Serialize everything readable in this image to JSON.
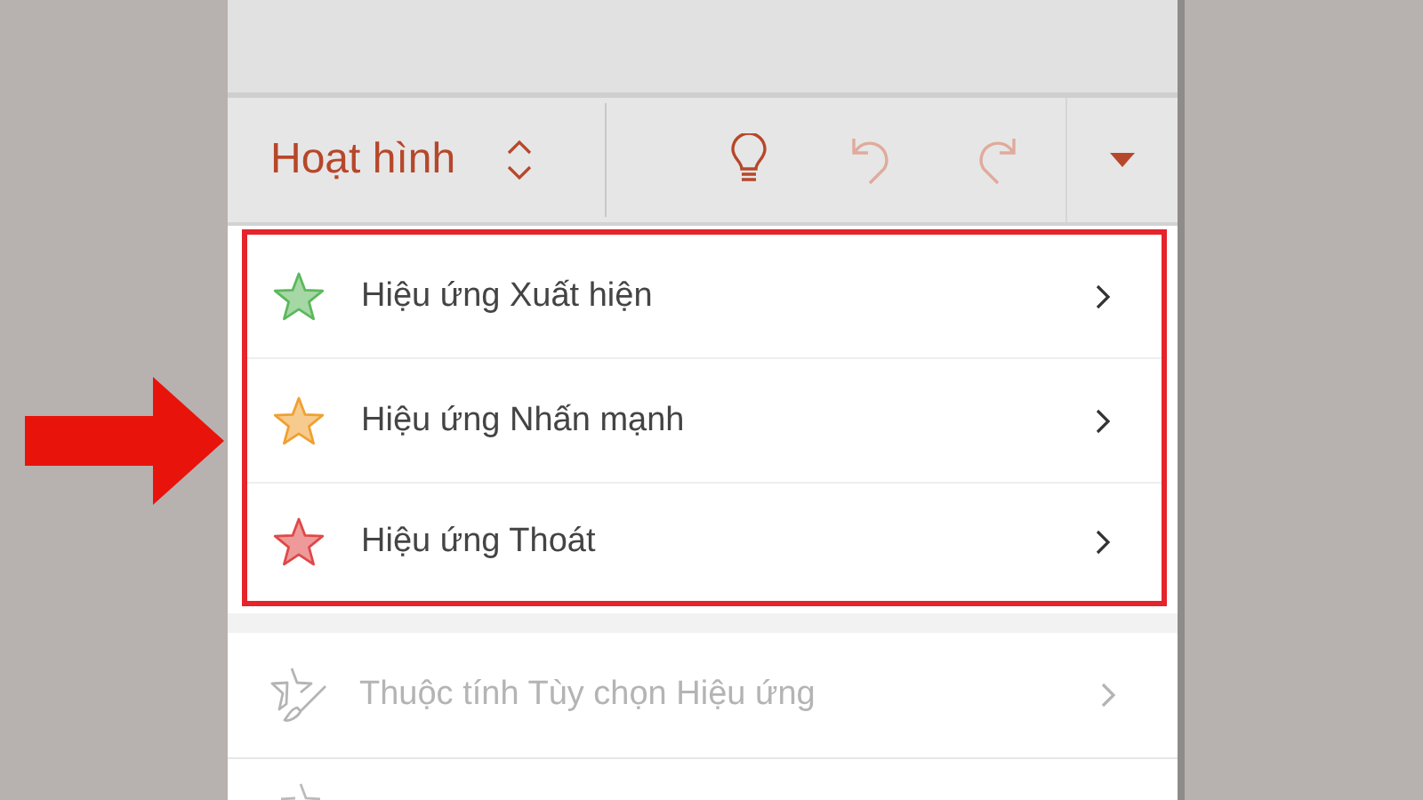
{
  "toolbar": {
    "title": "Hoạt hình",
    "buttons": [
      {
        "kind": "bulb",
        "disabled": false
      },
      {
        "kind": "undo",
        "disabled": true
      },
      {
        "kind": "redo",
        "disabled": true
      }
    ]
  },
  "effects": [
    {
      "label": "Hiệu ứng Xuất hiện",
      "color": "#5cb85c"
    },
    {
      "label": "Hiệu ứng Nhấn mạnh",
      "color": "#f0a030"
    },
    {
      "label": "Hiệu ứng Thoát",
      "color": "#e04848"
    }
  ],
  "more_items": [
    {
      "label": "Thuộc tính Tùy chọn Hiệu ứng",
      "disabled": true
    }
  ]
}
